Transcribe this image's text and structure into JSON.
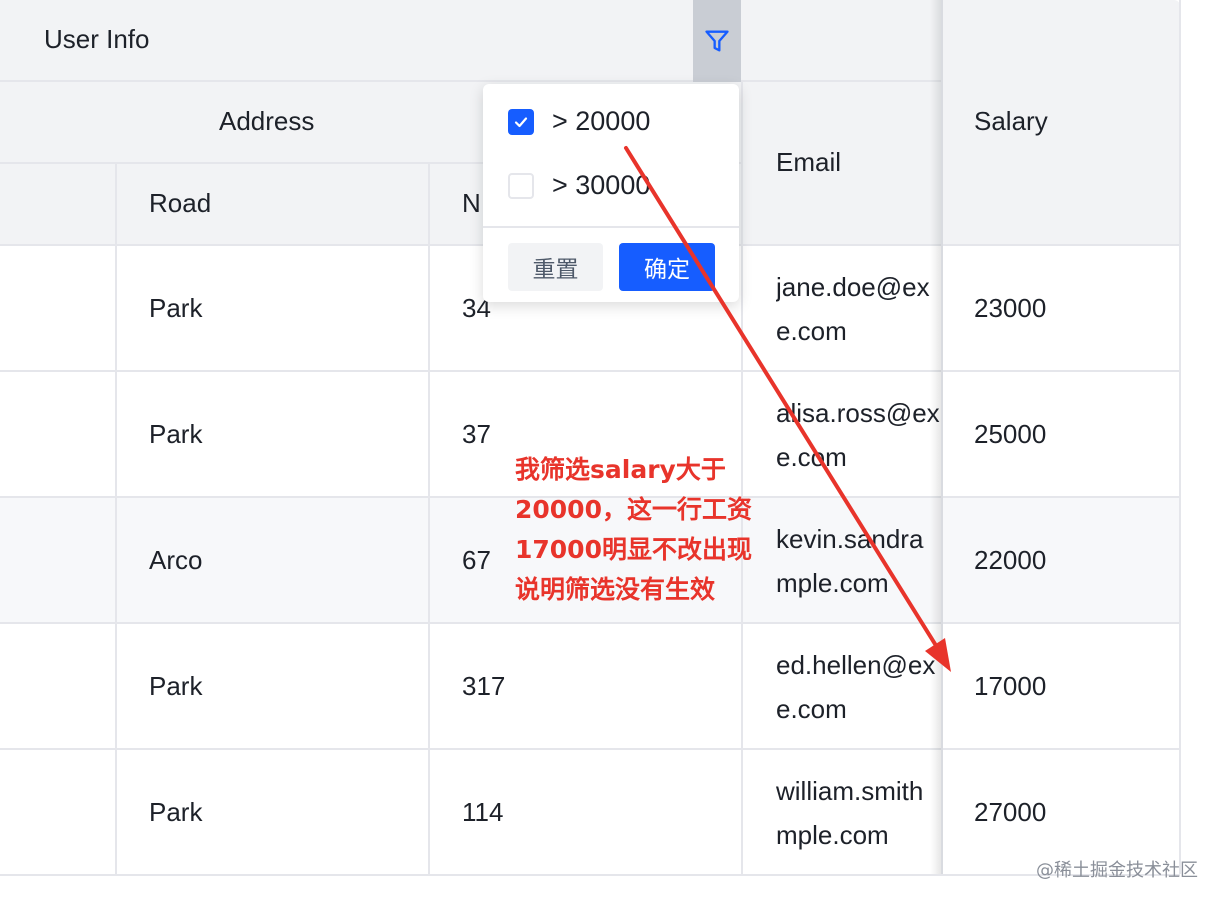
{
  "header": {
    "group_title": "User Info",
    "address_title": "Address",
    "road_label": "Road",
    "no_label": "N",
    "email_label": "Email",
    "salary_label": "Salary"
  },
  "rows": [
    {
      "road": "Park",
      "no": "34",
      "email_line1": "jane.doe@ex",
      "email_line2": "e.com",
      "salary": "23000"
    },
    {
      "road": "Park",
      "no": "37",
      "email_line1": "alisa.ross@ex",
      "email_line2": "e.com",
      "salary": "25000"
    },
    {
      "road": "Arco",
      "no": "67",
      "email_line1": "kevin.sandra",
      "email_line2": "mple.com",
      "salary": "22000"
    },
    {
      "road": "Park",
      "no": "317",
      "email_line1": "ed.hellen@ex",
      "email_line2": "e.com",
      "salary": "17000"
    },
    {
      "road": "Park",
      "no": "114",
      "email_line1": "william.smith",
      "email_line2": "mple.com",
      "salary": "27000"
    }
  ],
  "filter": {
    "options": [
      {
        "label": "> 20000",
        "checked": true
      },
      {
        "label": "> 30000",
        "checked": false
      }
    ],
    "reset_label": "重置",
    "confirm_label": "确定"
  },
  "annotation": {
    "lines": [
      "我筛选salary大于",
      "20000，这一行工资",
      "17000明显不改出现",
      "说明筛选没有生效"
    ]
  },
  "watermark": "@稀土掘金技术社区",
  "colors": {
    "primary": "#165dff",
    "annotation_red": "#e8342b",
    "header_bg": "#f2f3f5",
    "border": "#e5e6eb"
  }
}
